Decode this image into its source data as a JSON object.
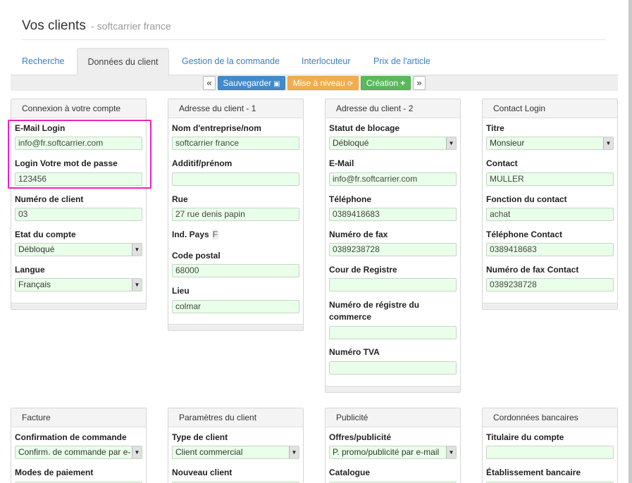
{
  "page": {
    "title": "Vos clients",
    "subtitle": "- softcarrier france"
  },
  "tabs": [
    {
      "label": "Recherche"
    },
    {
      "label": "Données du client"
    },
    {
      "label": "Gestion de la commande"
    },
    {
      "label": "Interlocuteur"
    },
    {
      "label": "Prix de l'article"
    }
  ],
  "active_tab": "Données du client",
  "toolbar": {
    "prev": "«",
    "save": "Sauvegarder",
    "update": "Mise à niveau",
    "create": "Création",
    "next": "»"
  },
  "panels": {
    "connexion": {
      "title": "Connexion à votre compte",
      "email_label": "E-Mail Login",
      "email_value": "info@fr.softcarrier.com",
      "password_label": "Login Votre mot de passe",
      "password_value": "123456",
      "client_no_label": "Numéro de client",
      "client_no_value": "03",
      "state_label": "Etat du compte",
      "state_value": "Débloqué",
      "lang_label": "Langue",
      "lang_value": "Français"
    },
    "address1": {
      "title": "Adresse du client - 1",
      "company_label": "Nom d'entreprise/nom",
      "company_value": "softcarrier france",
      "additive_label": "Additif/prénom",
      "additive_value": "",
      "street_label": "Rue",
      "street_value": "27 rue denis papin",
      "country_label": "Ind. Pays",
      "country_value": "F",
      "zip_label": "Code postal",
      "zip_value": "68000",
      "city_label": "Lieu",
      "city_value": "colmar"
    },
    "address2": {
      "title": "Adresse du client - 2",
      "block_label": "Statut de blocage",
      "block_value": "Débloqué",
      "email_label": "E-Mail",
      "email_value": "info@fr.softcarrier.com",
      "phone_label": "Téléphone",
      "phone_value": "0389418683",
      "fax_label": "Numéro de fax",
      "fax_value": "0389238728",
      "court_label": "Cour de Registre",
      "court_value": "",
      "registry_label_1": "Numéro de régistre du",
      "registry_label_2": "commerce",
      "registry_value": "",
      "vat_label": "Numéro TVA",
      "vat_value": ""
    },
    "contact": {
      "title": "Contact Login",
      "title_label": "Titre",
      "title_value": "Monsieur",
      "contact_label": "Contact",
      "contact_value": "MULLER",
      "function_label": "Fonction du contact",
      "function_value": "achat",
      "phone_label": "Téléphone Contact",
      "phone_value": "0389418683",
      "fax_label": "Numéro de fax Contact",
      "fax_value": "0389238728"
    },
    "invoice": {
      "title": "Facture",
      "confirm_label": "Confirmation de commande",
      "confirm_value": "Confirm. de commande par e-",
      "payment_label": "Modes de paiement"
    },
    "params": {
      "title": "Paramètres du client",
      "type_label": "Type de client",
      "type_value": "Client commercial",
      "new_label": "Nouveau client"
    },
    "ads": {
      "title": "Publicité",
      "offers_label": "Offres/publicité",
      "offers_value": "P. promo/publicité par e-mail",
      "catalog_label": "Catalogue"
    },
    "bank": {
      "title": "Cordonnées bancaires",
      "holder_label": "Titulaire du compte",
      "holder_value": "",
      "bank_label": "Établissement bancaire"
    }
  },
  "colors": {
    "highlight": "#ee22bb",
    "input_bg": "#eaffea",
    "save_btn": "#428bca",
    "update_btn": "#f0ad4e",
    "create_btn": "#5cb85c",
    "tab_link": "#3d7fbf"
  }
}
